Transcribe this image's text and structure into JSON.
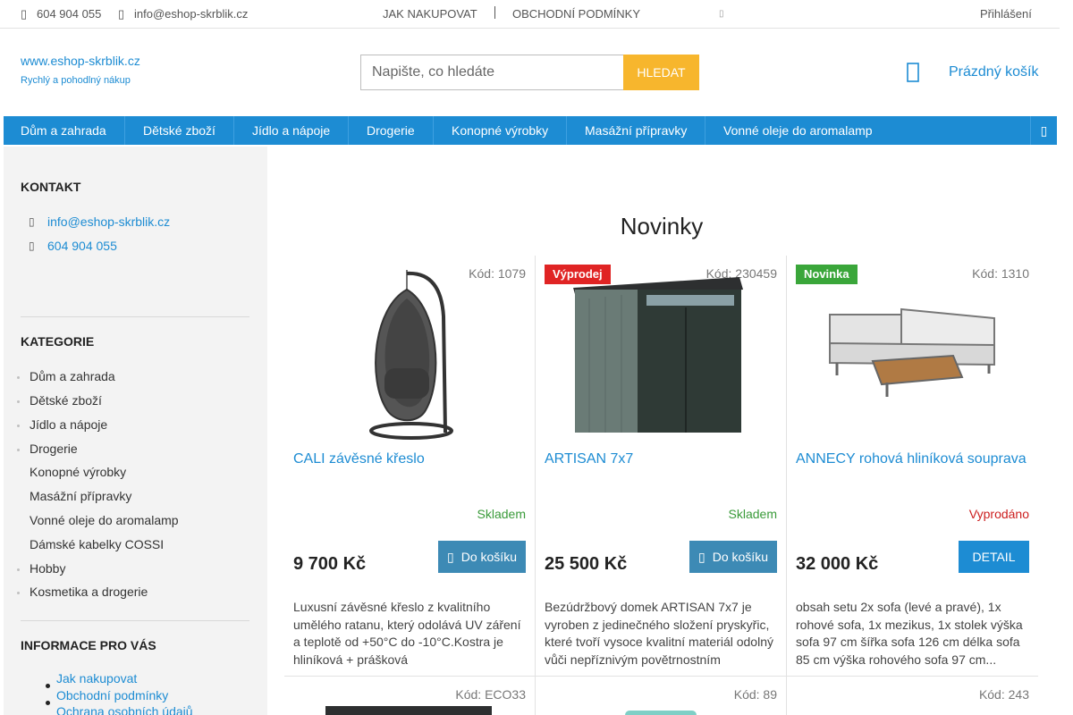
{
  "topbar": {
    "phone": "604 904 055",
    "email": "info@eshop-skrblik.cz",
    "links": [
      "JAK NAKUPOVAT",
      "OBCHODNÍ PODMÍNKY"
    ],
    "login": "Přihlášení"
  },
  "header": {
    "logo": "www.eshop-skrblik.cz",
    "tagline": "Rychlý a pohodlný nákup",
    "search_placeholder": "Napište, co hledáte",
    "search_button": "HLEDAT",
    "cart": "Prázdný košík"
  },
  "nav": [
    "Dům a zahrada",
    "Dětské zboží",
    "Jídlo a nápoje",
    "Drogerie",
    "Konopné výrobky",
    "Masážní přípravky",
    "Vonné oleje do aromalamp"
  ],
  "sidebar": {
    "contact_title": "KONTAKT",
    "contact_email": "info@eshop-skrblik.cz",
    "contact_phone": "604 904 055",
    "categories_title": "KATEGORIE",
    "categories": [
      "Dům a zahrada",
      "Dětské zboží",
      "Jídlo a nápoje",
      "Drogerie",
      "Konopné výrobky",
      "Masážní přípravky",
      "Vonné oleje do aromalamp",
      "Dámské kabelky COSSI",
      "Hobby",
      "Kosmetika a drogerie"
    ],
    "info_title": "INFORMACE PRO VÁS",
    "info_links": [
      "Jak nakupovat",
      "Obchodní podmínky",
      "Ochrana osobních údajů"
    ]
  },
  "main": {
    "title": "Novinky",
    "products": [
      {
        "code": "Kód: 1079",
        "badge": "",
        "name": "CALI závěsné křeslo",
        "stock": "Skladem",
        "price": "9 700 Kč",
        "button": "Do košíku",
        "description": "Luxusní závěsné křeslo z kvalitního umělého ratanu, který odolává UV záření a teplotě od +50°C do -10°C.Kostra je hliníková + prášková"
      },
      {
        "code": "Kód: 230459",
        "badge": "Výprodej",
        "name": "ARTISAN 7x7",
        "stock": "Skladem",
        "price": "25 500 Kč",
        "button": "Do košíku",
        "description": "Bezúdržbový domek ARTISAN 7x7 je vyroben z jedinečného složení pryskyřic, které tvoří vysoce kvalitní materiál odolný vůči nepříznivým povětrnostním"
      },
      {
        "code": "Kód: 1310",
        "badge": "Novinka",
        "name": "ANNECY rohová hliníková souprava",
        "stock": "Vyprodáno",
        "price": "32 000 Kč",
        "button": "DETAIL",
        "description": "obsah setu 2x sofa (levé a pravé), 1x rohové sofa, 1x mezikus, 1x stolek výška sofa 97 cm šířka sofa 126 cm délka sofa 85 cm výška rohového sofa 97 cm..."
      }
    ],
    "next_codes": [
      "Kód: ECO33",
      "Kód: 89",
      "Kód: 243"
    ]
  },
  "colors": {
    "accent": "#1d8cd3",
    "search_button": "#f7b62d",
    "sale_badge": "#e02424",
    "new_badge": "#3aa63a",
    "in_stock": "#3a9b3a",
    "out_of_stock": "#cc1f1f",
    "cart_button": "#3d8ab5"
  }
}
